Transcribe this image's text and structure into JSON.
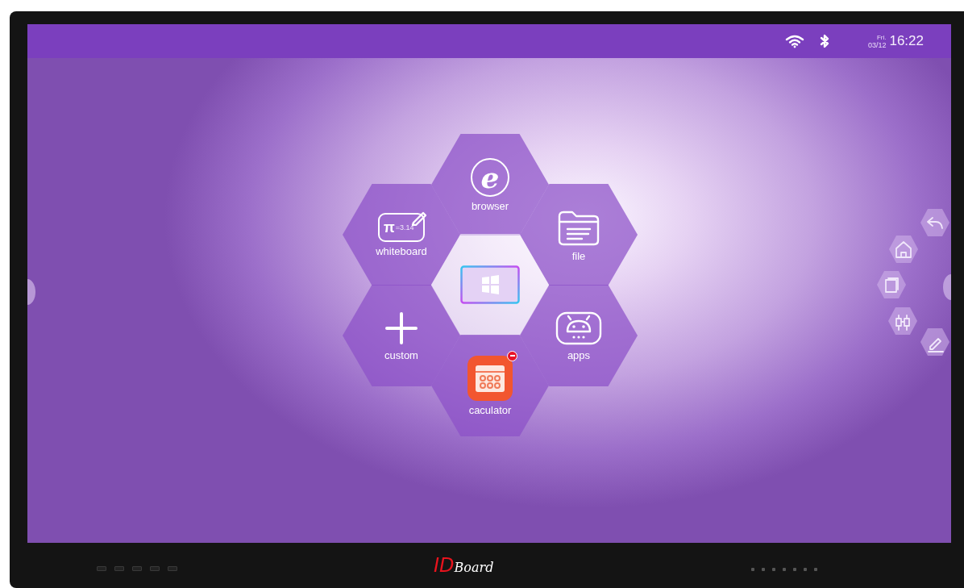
{
  "status_bar": {
    "day": "Fri.",
    "date": "03/12",
    "time": "16:22"
  },
  "tiles": [
    {
      "kind": "browser",
      "label": "browser",
      "icon_text": "e",
      "deletable": false
    },
    {
      "kind": "whiteboard",
      "label": "whiteboard",
      "icon_text": "π",
      "icon_subtext": "=3.14",
      "deletable": false
    },
    {
      "kind": "file",
      "label": "file",
      "deletable": false
    },
    {
      "kind": "windows",
      "deletable": false
    },
    {
      "kind": "custom",
      "label": "custom",
      "deletable": false
    },
    {
      "kind": "apps",
      "label": "apps",
      "deletable": false
    },
    {
      "kind": "calculator",
      "label": "caculator",
      "deletable": true
    }
  ],
  "bezel": {
    "logo_mark": "ID",
    "logo_text": "Board"
  }
}
